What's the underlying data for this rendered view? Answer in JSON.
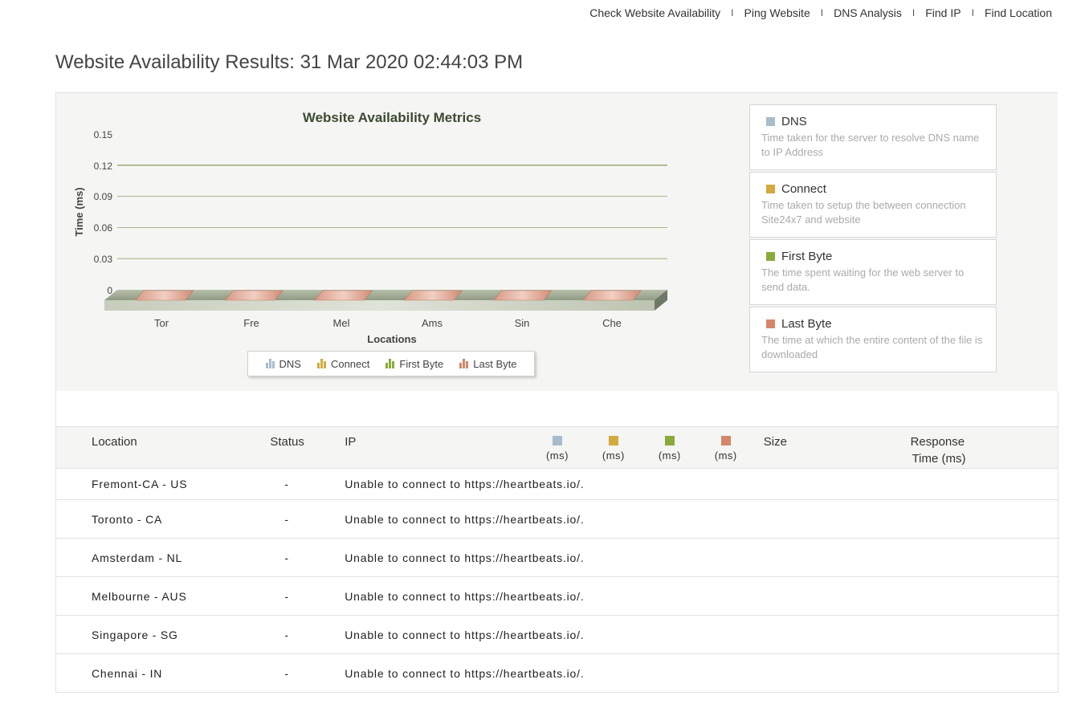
{
  "nav": {
    "items": [
      "Check Website Availability",
      "Ping Website",
      "DNS Analysis",
      "Find IP",
      "Find Location"
    ],
    "separator": "I"
  },
  "page_title": "Website Availability Results: 31 Mar 2020 02:44:03 PM",
  "colors": {
    "dns": "#a7bccc",
    "connect": "#d4a940",
    "first_byte": "#8aab3c",
    "last_byte": "#d4876a"
  },
  "chart_data": {
    "type": "bar",
    "title": "Website Availability Metrics",
    "xlabel": "Locations",
    "ylabel": "Time (ms)",
    "ylim": [
      0,
      0.15
    ],
    "yticks": [
      "0.15",
      "0.12",
      "0.09",
      "0.06",
      "0.03",
      "0"
    ],
    "categories": [
      "Tor",
      "Fre",
      "Mel",
      "Ams",
      "Sin",
      "Che"
    ],
    "series": [
      {
        "name": "DNS",
        "values": [
          0,
          0,
          0,
          0,
          0,
          0
        ]
      },
      {
        "name": "Connect",
        "values": [
          0,
          0,
          0,
          0,
          0,
          0
        ]
      },
      {
        "name": "First Byte",
        "values": [
          0,
          0,
          0,
          0,
          0,
          0
        ]
      },
      {
        "name": "Last Byte",
        "values": [
          0,
          0,
          0,
          0,
          0,
          0
        ]
      }
    ],
    "grid": true,
    "legend_position": "bottom"
  },
  "legend": [
    {
      "title": "DNS",
      "desc": "Time taken for the server to resolve DNS name to IP Address"
    },
    {
      "title": "Connect",
      "desc": "Time taken to setup the between connection Site24x7 and website"
    },
    {
      "title": "First Byte",
      "desc": "The time spent waiting for the web server to send data."
    },
    {
      "title": "Last Byte",
      "desc": "The time at which the entire content of the file is downloaded"
    }
  ],
  "table": {
    "headers": {
      "location": "Location",
      "status": "Status",
      "ip": "IP",
      "ms": "(ms)",
      "size": "Size",
      "response_l1": "Response",
      "response_l2": "Time (ms)"
    },
    "rows": [
      {
        "location": "Fremont-CA - US",
        "status": "-",
        "message": "Unable to connect to https://heartbeats.io/."
      },
      {
        "location": "Toronto - CA",
        "status": "-",
        "message": "Unable to connect to https://heartbeats.io/."
      },
      {
        "location": "Amsterdam - NL",
        "status": "-",
        "message": "Unable to connect to https://heartbeats.io/."
      },
      {
        "location": "Melbourne - AUS",
        "status": "-",
        "message": "Unable to connect to https://heartbeats.io/."
      },
      {
        "location": "Singapore - SG",
        "status": "-",
        "message": "Unable to connect to https://heartbeats.io/."
      },
      {
        "location": "Chennai - IN",
        "status": "-",
        "message": "Unable to connect to https://heartbeats.io/."
      }
    ]
  }
}
